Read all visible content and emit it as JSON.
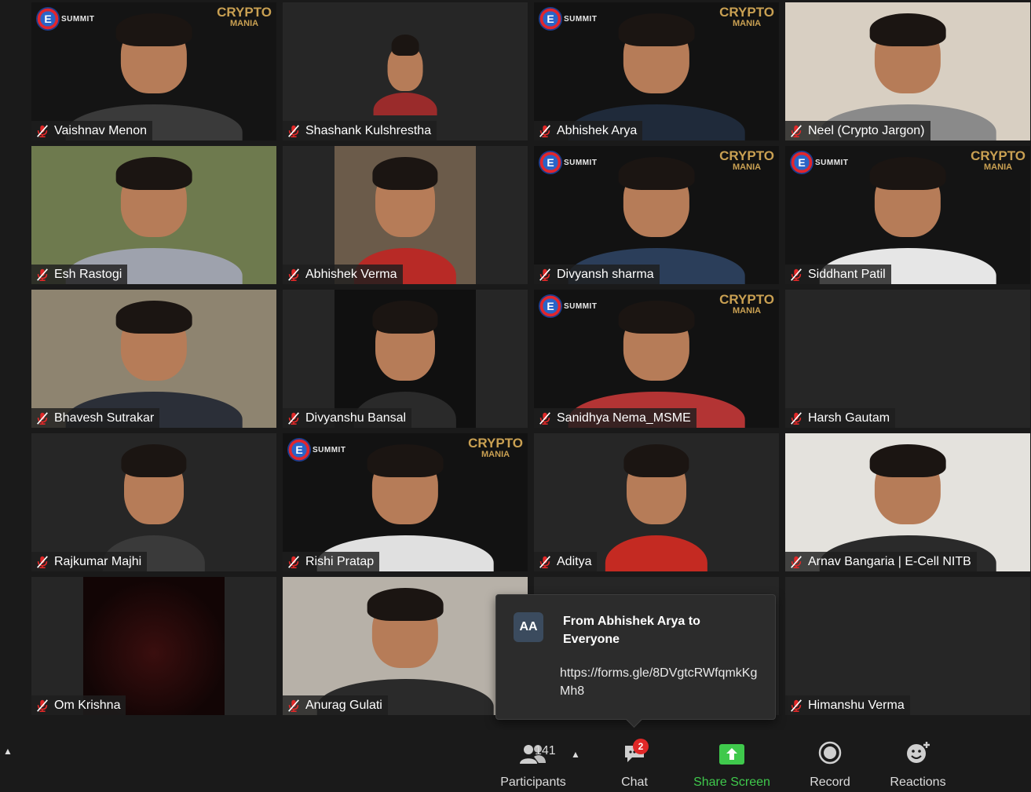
{
  "branding": {
    "esummit_letter": "E",
    "esummit_text": "SUMMIT",
    "crypto_line1": "CRYPTO",
    "crypto_line2": "MANIA"
  },
  "participants_tiles": [
    {
      "name": "Vaishnav Menon",
      "bg": "#141414",
      "layout": "full",
      "branded": true,
      "shirt": "#3a3a3a"
    },
    {
      "name": "Shashank Kulshrestha",
      "bg": "#262626",
      "layout": "small",
      "branded": false,
      "shirt": "#9a2b2b"
    },
    {
      "name": "Abhishek Arya",
      "bg": "#121212",
      "layout": "full",
      "branded": true,
      "shirt": "#1f2a3a"
    },
    {
      "name": "Neel (Crypto Jargon)",
      "bg": "#d8cfc2",
      "layout": "full",
      "branded": false,
      "shirt": "#8a8a8a"
    },
    {
      "name": "Esh Rastogi",
      "bg": "#6e7a4e",
      "layout": "full",
      "branded": false,
      "shirt": "#9ea2ad"
    },
    {
      "name": "Abhishek Verma",
      "bg": "#6b5b4a",
      "layout": "mid",
      "branded": false,
      "shirt": "#b82a26"
    },
    {
      "name": "Divyansh sharma",
      "bg": "#121212",
      "layout": "full",
      "branded": true,
      "shirt": "#2b3e5a"
    },
    {
      "name": "Siddhant Patil",
      "bg": "#141414",
      "layout": "full",
      "branded": true,
      "shirt": "#e6e6e6"
    },
    {
      "name": "Bhavesh Sutrakar",
      "bg": "#8e8470",
      "layout": "full",
      "branded": false,
      "shirt": "#2b2f38"
    },
    {
      "name": "Divyanshu Bansal",
      "bg": "#101010",
      "layout": "mid",
      "branded": false,
      "shirt": "#2a2a2a"
    },
    {
      "name": "Sanidhya Nema_MSME",
      "bg": "#121212",
      "layout": "full",
      "branded": true,
      "shirt": "#b33434"
    },
    {
      "name": "Harsh Gautam",
      "bg": "#262626",
      "layout": "none",
      "branded": false,
      "shirt": "#262626"
    },
    {
      "name": "Rajkumar Majhi",
      "bg": "#262626",
      "layout": "mid",
      "branded": false,
      "shirt": "#3a3a3a"
    },
    {
      "name": "Rishi Pratap",
      "bg": "#121212",
      "layout": "full",
      "branded": true,
      "shirt": "#e0e0e0"
    },
    {
      "name": "Aditya",
      "bg": "#262626",
      "layout": "mid",
      "branded": false,
      "shirt": "#c42a22"
    },
    {
      "name": "Arnav Bangaria | E-Cell NITB",
      "bg": "#e4e2dd",
      "layout": "full",
      "branded": false,
      "shirt": "#2a2a2a"
    },
    {
      "name": "Om Krishna",
      "bg": "#262626",
      "layout": "dark",
      "branded": false,
      "shirt": "#1a0a0a"
    },
    {
      "name": "Anurag Gulati",
      "bg": "#b7b1a8",
      "layout": "full",
      "branded": false,
      "shirt": "#2a2a2a"
    },
    {
      "name": "",
      "bg": "#262626",
      "layout": "none",
      "branded": false,
      "shirt": "#262626"
    },
    {
      "name": "Himanshu Verma",
      "bg": "#262626",
      "layout": "none",
      "branded": false,
      "shirt": "#262626"
    }
  ],
  "chat_popup": {
    "avatar_initials": "AA",
    "from": "From Abhishek Arya to Everyone",
    "message": "https://forms.gle/8DVgtcRWfqmkKgMh8"
  },
  "toolbar": {
    "participants_label": "Participants",
    "participants_count": "141",
    "chat_label": "Chat",
    "chat_badge": "2",
    "share_label": "Share Screen",
    "record_label": "Record",
    "reactions_label": "Reactions"
  },
  "colors": {
    "share_green": "#3fc94c",
    "badge_red": "#e02828",
    "muted_red": "#e02828"
  }
}
